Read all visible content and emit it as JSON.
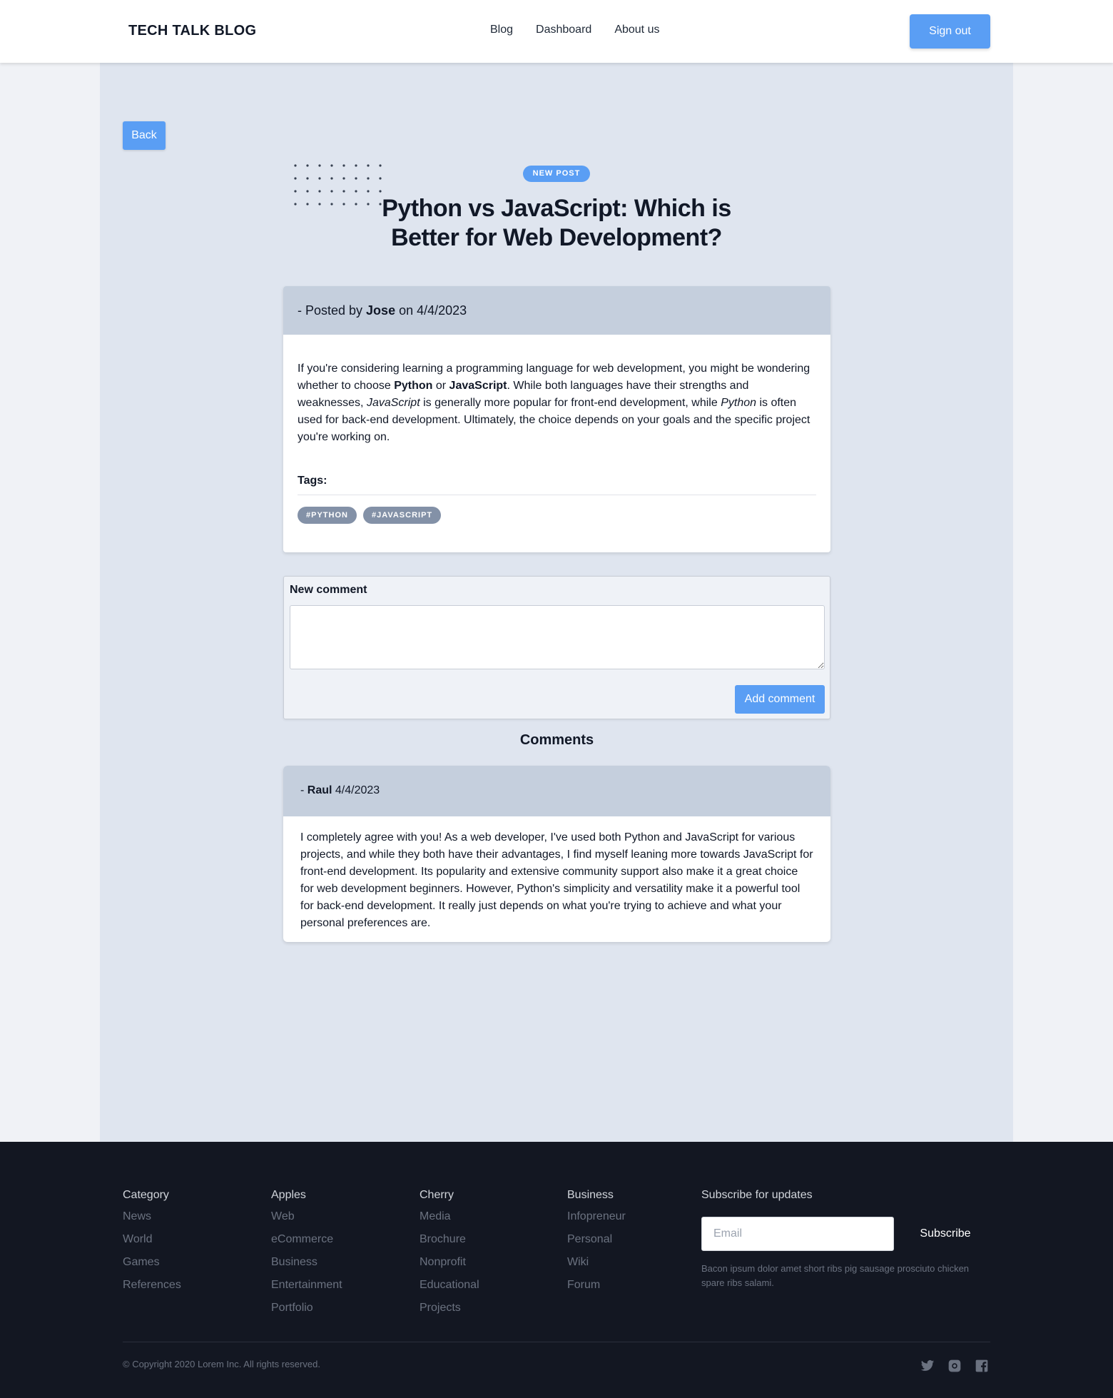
{
  "header": {
    "brand": "TECH TALK BLOG",
    "nav": [
      {
        "label": "Blog"
      },
      {
        "label": "Dashboard"
      },
      {
        "label": "About us"
      }
    ],
    "sign_out": "Sign out"
  },
  "back_label": "Back",
  "post": {
    "badge": "NEW POST",
    "title": "Python vs JavaScript: Which is Better for Web Development?",
    "posted_prefix": "- Posted by ",
    "author": "Jose",
    "posted_on": " on ",
    "date": "4/4/2023",
    "body": {
      "t1": "If you're considering learning a programming language for web development, you might be wondering whether to choose ",
      "b1": "Python",
      "t2": " or ",
      "b2": "JavaScript",
      "t3": ". While both languages have their strengths and weaknesses, ",
      "i1": "JavaScript",
      "t4": " is generally more popular for front-end development, while ",
      "i2": "Python",
      "t5": " is often used for back-end development. Ultimately, the choice depends on your goals and the specific project you're working on."
    },
    "tags_label": "Tags:",
    "tags": [
      "#PYTHON",
      "#JAVASCRIPT"
    ]
  },
  "comment_form": {
    "label": "New comment",
    "value": "",
    "submit": "Add comment"
  },
  "comments_heading": "Comments",
  "comments": [
    {
      "prefix": "- ",
      "author": "Raul",
      "date": " 4/4/2023",
      "text": "I completely agree with you! As a web developer, I've used both Python and JavaScript for various projects, and while they both have their advantages, I find myself leaning more towards JavaScript for front-end development. Its popularity and extensive community support also make it a great choice for web development beginners. However, Python's simplicity and versatility make it a powerful tool for back-end development. It really just depends on what you're trying to achieve and what your personal preferences are."
    }
  ],
  "footer": {
    "columns": [
      {
        "title": "Category",
        "links": [
          "News",
          "World",
          "Games",
          "References"
        ]
      },
      {
        "title": "Apples",
        "links": [
          "Web",
          "eCommerce",
          "Business",
          "Entertainment",
          "Portfolio"
        ]
      },
      {
        "title": "Cherry",
        "links": [
          "Media",
          "Brochure",
          "Nonprofit",
          "Educational",
          "Projects"
        ]
      },
      {
        "title": "Business",
        "links": [
          "Infopreneur",
          "Personal",
          "Wiki",
          "Forum"
        ]
      }
    ],
    "subscribe": {
      "title": "Subscribe for updates",
      "placeholder": "Email",
      "button": "Subscribe",
      "note": "Bacon ipsum dolor amet short ribs pig sausage prosciuto chicken spare ribs salami."
    },
    "copyright": "© Copyright 2020 Lorem Inc. All rights reserved.",
    "social_icons": [
      "twitter-icon",
      "instagram-icon",
      "facebook-icon"
    ]
  },
  "colors": {
    "accent": "#5a9ef4",
    "footer_bg": "#131722",
    "main_bg": "#dfe5ef",
    "card_header": "#c5cfdd",
    "tag_bg": "#8391a7"
  }
}
